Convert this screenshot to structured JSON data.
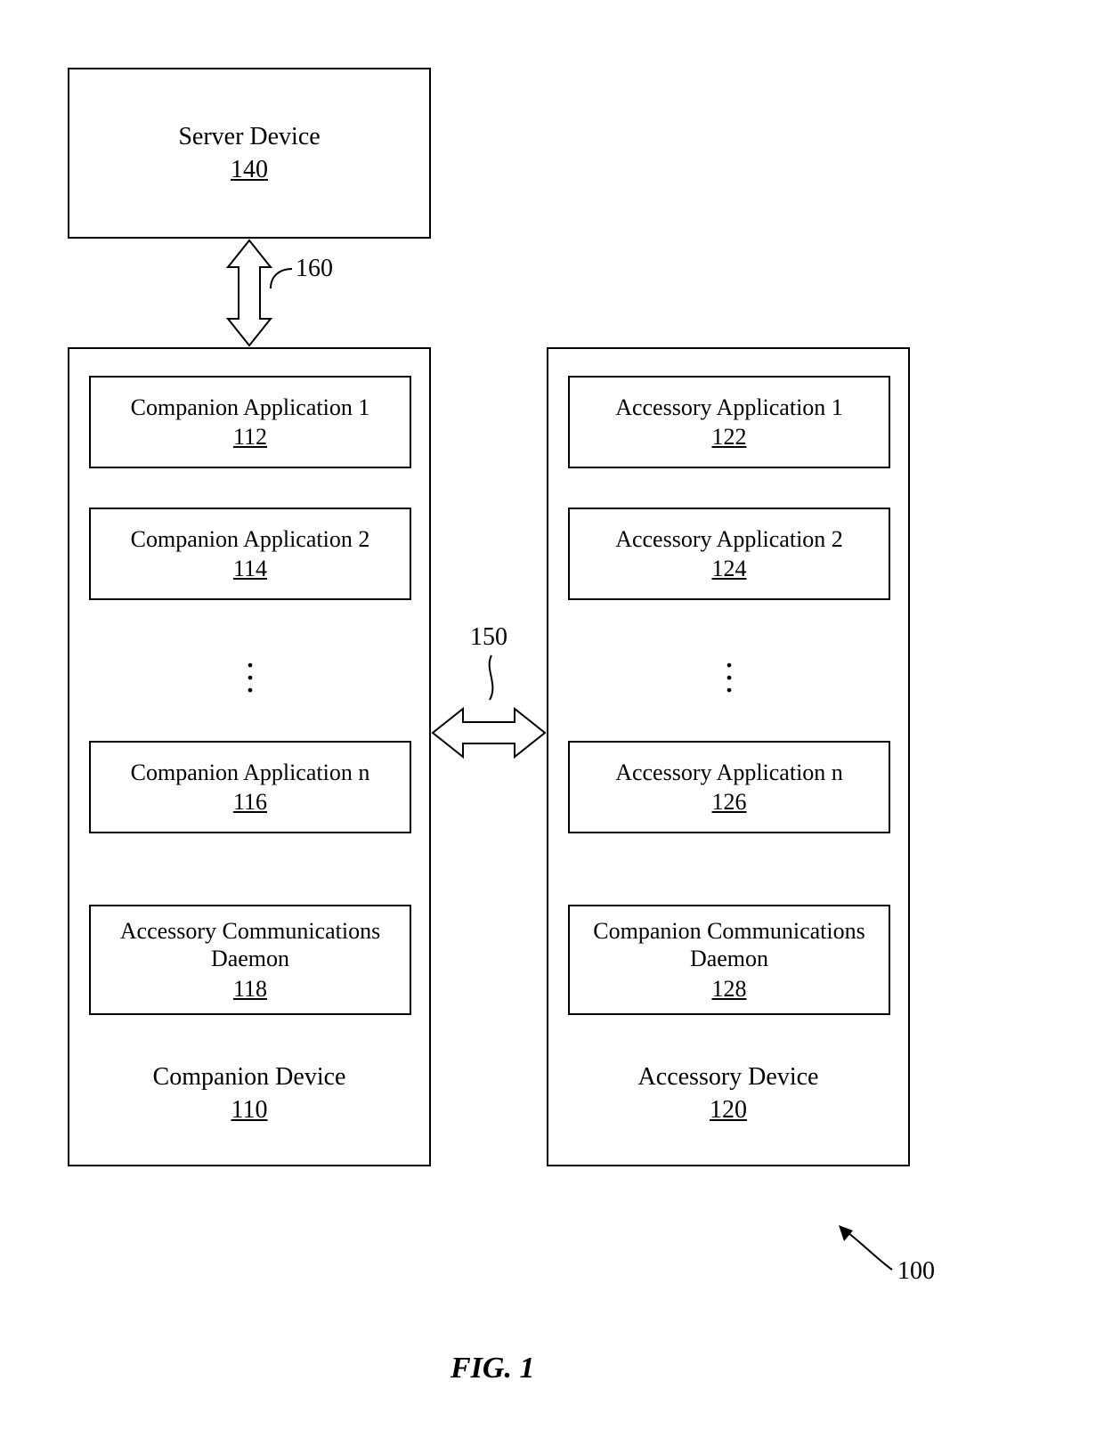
{
  "server": {
    "title": "Server Device",
    "ref": "140"
  },
  "companion_device": {
    "label": "Companion Device",
    "ref": "110",
    "apps": [
      {
        "title": "Companion Application 1",
        "ref": "112"
      },
      {
        "title": "Companion Application 2",
        "ref": "114"
      },
      {
        "title": "Companion Application n",
        "ref": "116"
      }
    ],
    "daemon": {
      "title": "Accessory Communications Daemon",
      "ref": "118"
    }
  },
  "accessory_device": {
    "label": "Accessory Device",
    "ref": "120",
    "apps": [
      {
        "title": "Accessory Application 1",
        "ref": "122"
      },
      {
        "title": "Accessory Application 2",
        "ref": "124"
      },
      {
        "title": "Accessory Application n",
        "ref": "126"
      }
    ],
    "daemon": {
      "title": "Companion Communications Daemon",
      "ref": "128"
    }
  },
  "links": {
    "server_companion": "160",
    "devices": "150"
  },
  "system_ref": "100",
  "figure": "FIG. 1"
}
